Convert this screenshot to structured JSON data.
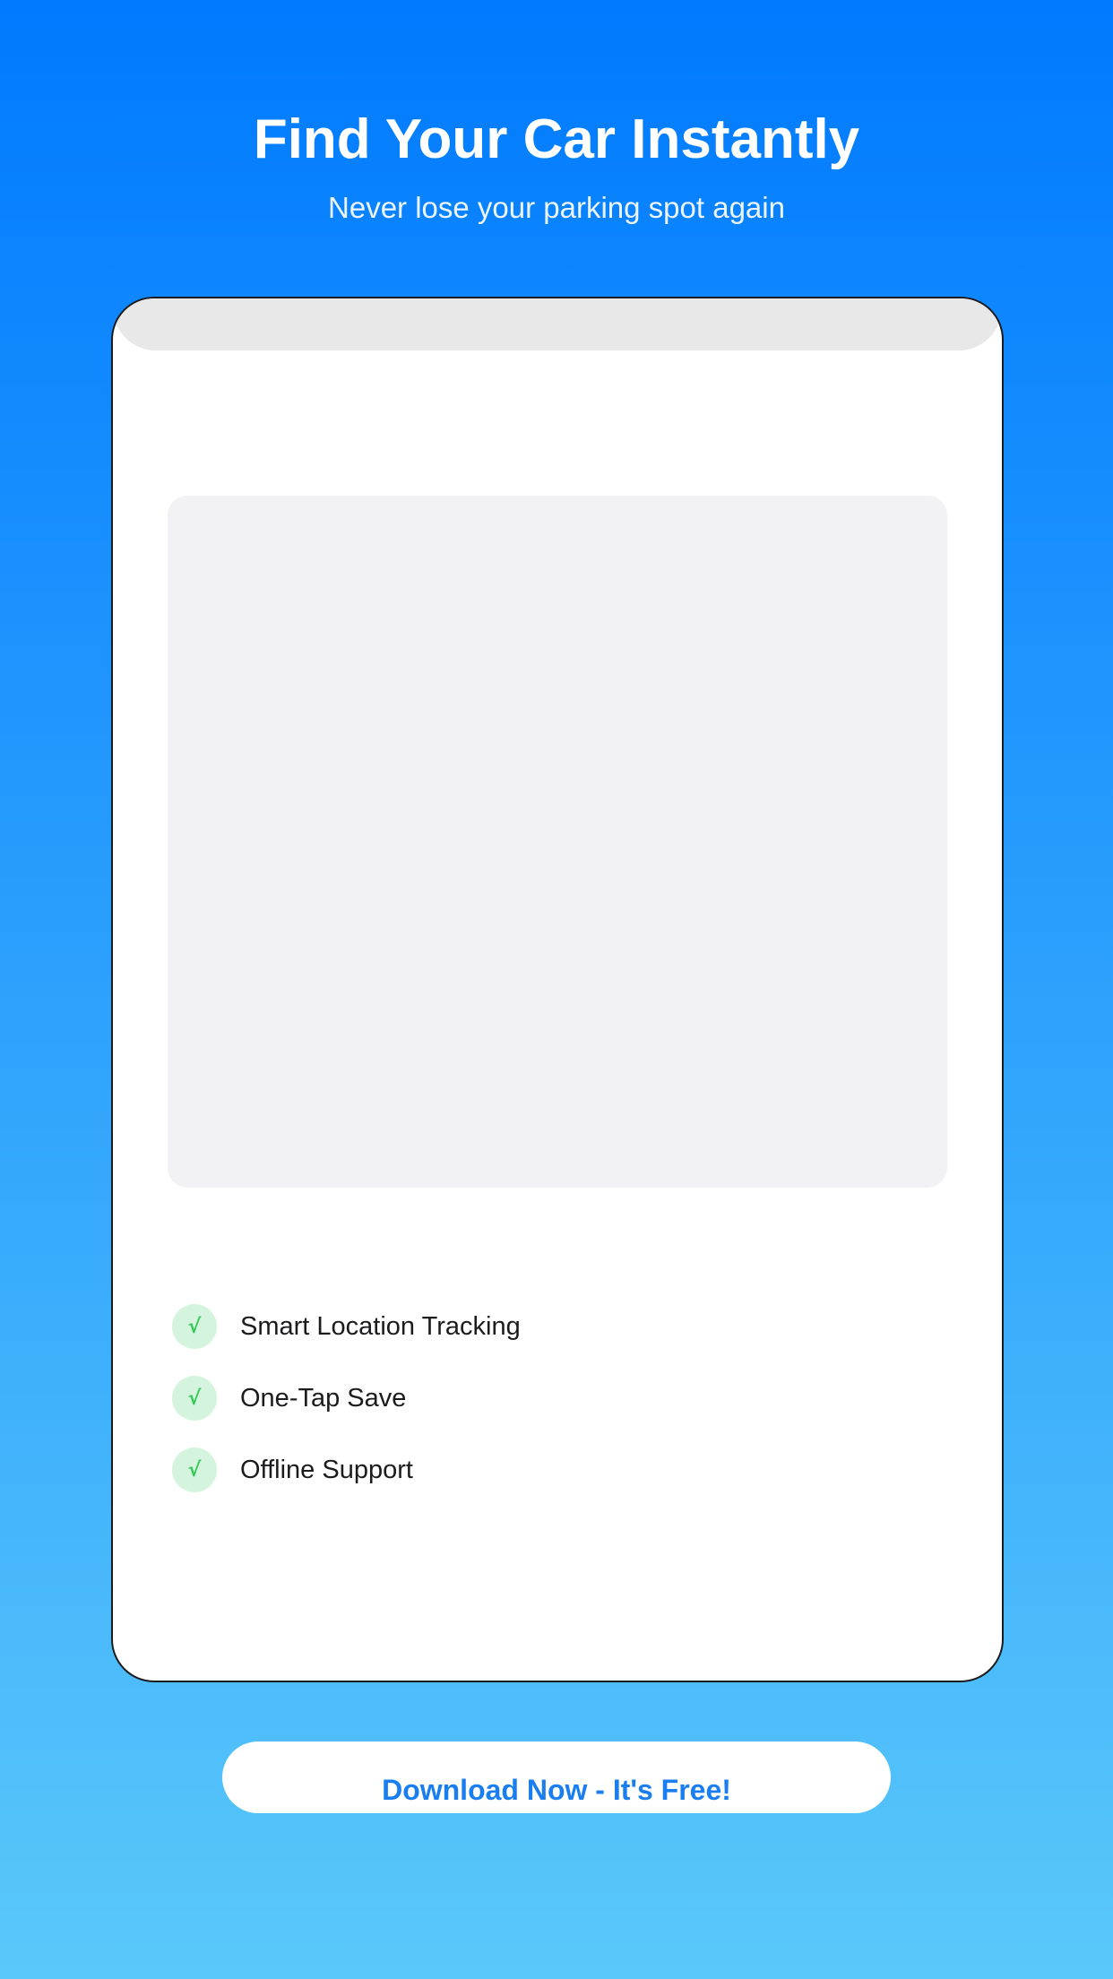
{
  "hero": {
    "title": "Find Your Car Instantly",
    "subtitle": "Never lose your parking spot again"
  },
  "features": [
    {
      "icon": "checkmark-icon",
      "check_glyph": "√",
      "label": "Smart Location Tracking"
    },
    {
      "icon": "checkmark-icon",
      "check_glyph": "√",
      "label": "One-Tap Save"
    },
    {
      "icon": "checkmark-icon",
      "check_glyph": "√",
      "label": "Offline Support"
    }
  ],
  "cta": {
    "label": "Download Now - It's Free!"
  },
  "colors": {
    "gradient_top": "#007AFF",
    "gradient_bottom": "#5AC8FA",
    "check_green": "#34C759",
    "check_bg": "#D4F4DE",
    "cta_text": "#1A7EF0"
  }
}
